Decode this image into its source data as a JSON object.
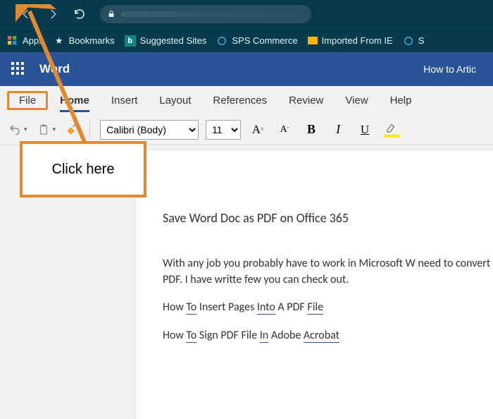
{
  "browser": {
    "bookmarks": {
      "apps": "Apps",
      "bookmarks": "Bookmarks",
      "suggested": "Suggested Sites",
      "sps": "SPS Commerce",
      "imported": "Imported From IE",
      "more": "S"
    }
  },
  "word_header": {
    "app_name": "Word",
    "doc_title": "How to Artic"
  },
  "ribbon": {
    "tabs": {
      "file": "File",
      "home": "Home",
      "insert": "Insert",
      "layout": "Layout",
      "references": "References",
      "review": "Review",
      "view": "View",
      "help": "Help"
    }
  },
  "toolbar": {
    "font": "Calibri (Body)",
    "size": "11",
    "bold": "B",
    "italic": "I",
    "underline": "U",
    "grow_font": "A",
    "shrink_font": "A"
  },
  "document": {
    "title": "Save Word Doc as PDF on Office 365",
    "para1": "With any job you probably have to work in Microsoft W need to convert that word doc into a PDF. I have writte few you can check out.",
    "link1_pre": "How ",
    "link1_to": "To",
    "link1_mid": " Insert Pages ",
    "link1_into": "Into",
    "link1_pdf": " A PDF ",
    "link1_file": "File",
    "link2_pre": "How ",
    "link2_to": "To",
    "link2_mid": " Sign PDF File ",
    "link2_in": "In",
    "link2_mid2": " Adobe ",
    "link2_ac": "Acrobat"
  },
  "annotation": {
    "text": "Click here"
  }
}
